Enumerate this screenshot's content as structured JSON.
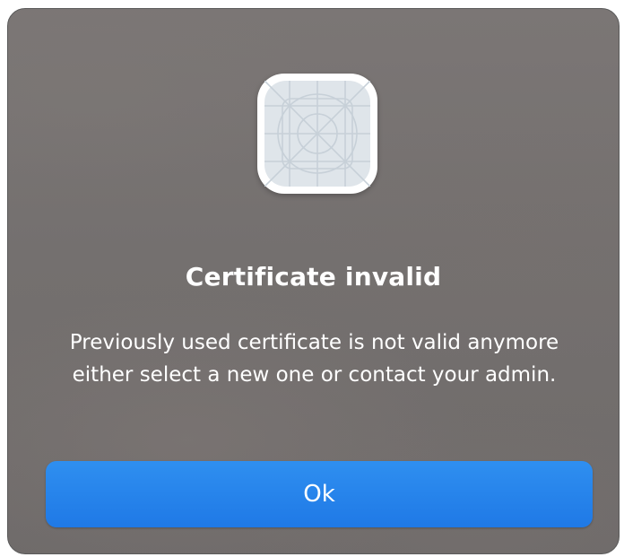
{
  "dialog": {
    "icon": "app-placeholder-grid-icon",
    "title": "Certificate invalid",
    "message": "Previously used certificate is not valid anymore either select a new one or contact your admin.",
    "ok_label": "Ok"
  },
  "colors": {
    "dialog_background": "#74706f",
    "button_accent": "#1f79e6",
    "text": "#ffffff",
    "icon_fill": "#dfe5ea",
    "icon_lines": "#c7d0d8"
  }
}
